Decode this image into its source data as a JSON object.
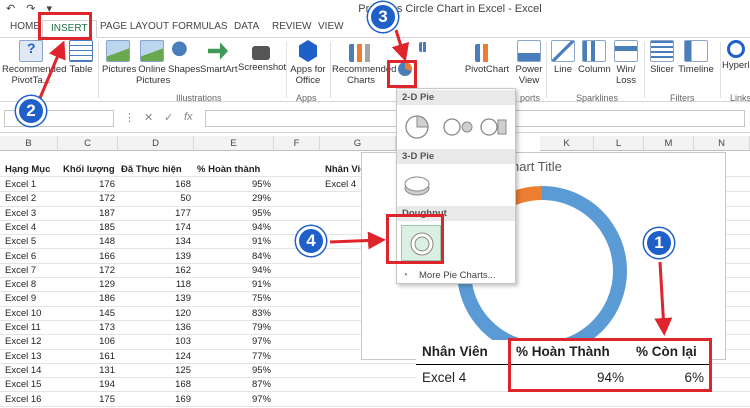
{
  "window": {
    "title": "Progress Circle Chart in Excel - Excel"
  },
  "tabs": [
    {
      "label": "HOME"
    },
    {
      "label": "INSERT"
    },
    {
      "label": "PAGE LAYOUT"
    },
    {
      "label": "FORMULAS"
    },
    {
      "label": "DATA"
    },
    {
      "label": "REVIEW"
    },
    {
      "label": "VIEW"
    }
  ],
  "ribbon": {
    "recommended_pivottables": "Recommended PivotTa...",
    "table": "Table",
    "pictures": "Pictures",
    "online_pictures": "Online Pictures",
    "shapes": "Shapes",
    "smartart": "SmartArt",
    "screenshot": "Screenshot",
    "apps_for_office": "Apps for Office",
    "recommended_charts": "Recommended Charts",
    "pivotchart": "PivotChart",
    "power_view": "Power View",
    "line": "Line",
    "column": "Column",
    "win_loss": "Win/ Loss",
    "slicer": "Slicer",
    "timeline": "Timeline",
    "hyperlink": "Hyperli",
    "groups": {
      "illustrations": "Illustrations",
      "apps": "Apps",
      "reports": "ports",
      "sparklines": "Sparklines",
      "filters": "Filters",
      "links": "Links"
    }
  },
  "columns": [
    "B",
    "C",
    "D",
    "E",
    "F",
    "G",
    "K",
    "L",
    "M",
    "N"
  ],
  "sheet": {
    "headers": [
      "Hạng Mục",
      "Khối lượng",
      "Đã Thực hiện",
      "% Hoàn thành"
    ],
    "rows": [
      [
        "Excel 1",
        "176",
        "168",
        "95%"
      ],
      [
        "Excel 2",
        "172",
        "50",
        "29%"
      ],
      [
        "Excel 3",
        "187",
        "177",
        "95%"
      ],
      [
        "Excel 4",
        "185",
        "174",
        "94%"
      ],
      [
        "Excel 5",
        "148",
        "134",
        "91%"
      ],
      [
        "Excel 6",
        "166",
        "139",
        "84%"
      ],
      [
        "Excel 7",
        "172",
        "162",
        "94%"
      ],
      [
        "Excel 8",
        "129",
        "118",
        "91%"
      ],
      [
        "Excel 9",
        "186",
        "139",
        "75%"
      ],
      [
        "Excel 10",
        "145",
        "120",
        "83%"
      ],
      [
        "Excel 11",
        "173",
        "136",
        "79%"
      ],
      [
        "Excel 12",
        "106",
        "103",
        "97%"
      ],
      [
        "Excel 13",
        "161",
        "124",
        "77%"
      ],
      [
        "Excel 14",
        "131",
        "125",
        "95%"
      ],
      [
        "Excel 15",
        "194",
        "168",
        "87%"
      ],
      [
        "Excel 16",
        "175",
        "169",
        "97%"
      ]
    ],
    "g_header": "Nhân Viê",
    "g_value": "Excel 4"
  },
  "chart": {
    "title": "hart Title"
  },
  "chart_data": {
    "type": "pie",
    "style": "doughnut",
    "values": [
      94,
      6
    ],
    "colors": [
      "#5b9bd5",
      "#ed7d31"
    ]
  },
  "dropdown": {
    "section_2d": "2-D Pie",
    "section_3d": "3-D Pie",
    "section_doughnut": "Doughnut",
    "more": "More Pie Charts..."
  },
  "data_table": {
    "headers": [
      "Nhân Viên",
      "% Hoàn Thành",
      "% Còn lại"
    ],
    "row": [
      "Excel 4",
      "94%",
      "6%"
    ]
  },
  "annotations": {
    "badges": [
      "1",
      "2",
      "3",
      "4"
    ],
    "color": "#e0242c",
    "badge_color": "#1f5fc8"
  }
}
